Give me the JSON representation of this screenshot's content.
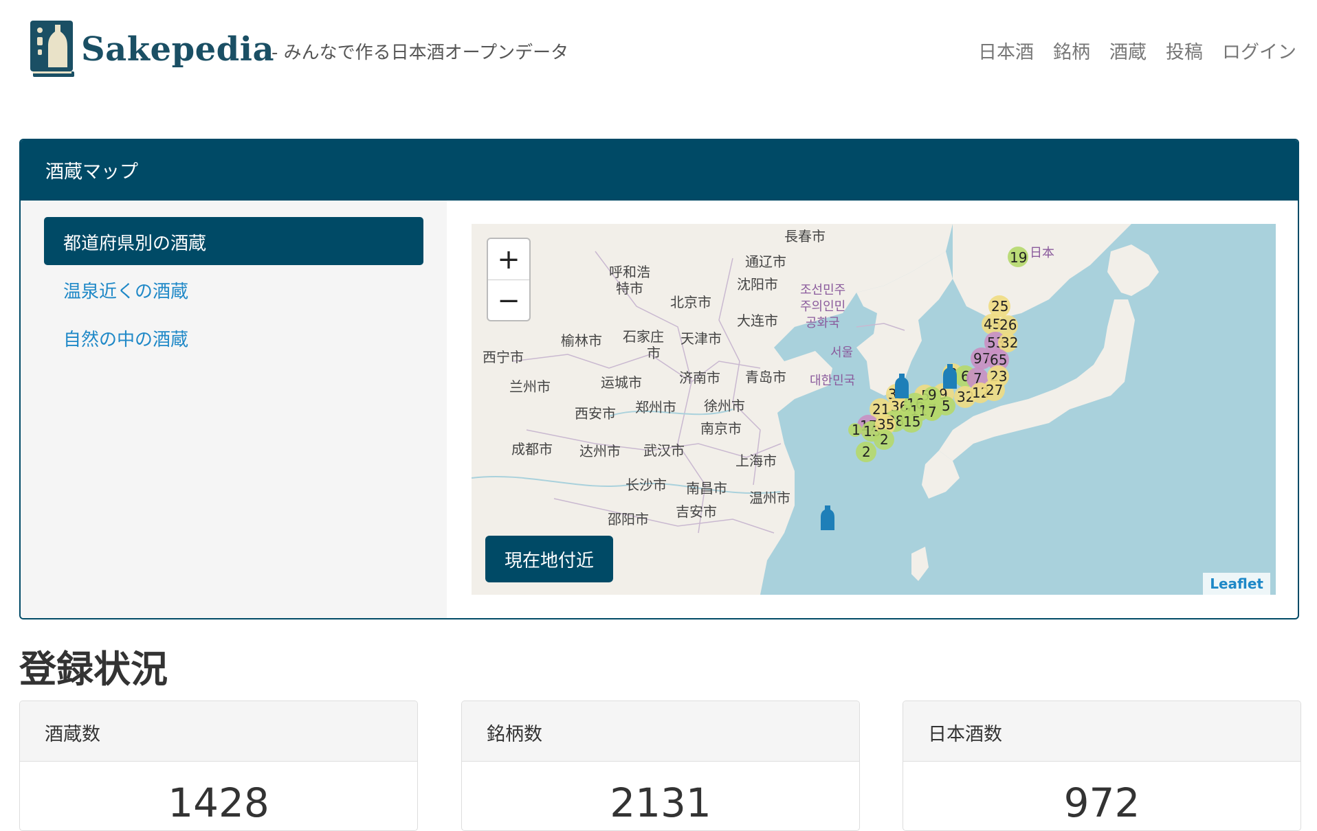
{
  "brand": {
    "name": "Sakepedia",
    "tagline": "- みんなで作る日本酒オープンデータ"
  },
  "nav": [
    {
      "label": "日本酒"
    },
    {
      "label": "銘柄"
    },
    {
      "label": "酒蔵"
    },
    {
      "label": "投稿"
    },
    {
      "label": "ログイン"
    }
  ],
  "panel": {
    "title": "酒蔵マップ",
    "menu": [
      {
        "label": "都道府県別の酒蔵",
        "active": true
      },
      {
        "label": "温泉近くの酒蔵",
        "active": false
      },
      {
        "label": "自然の中の酒蔵",
        "active": false
      }
    ]
  },
  "map": {
    "zoom_in": "+",
    "zoom_out": "−",
    "locate_button": "現在地付近",
    "attribution": "Leaflet",
    "cities": [
      "長春市",
      "通辽市",
      "呼和浩",
      "特市",
      "沈阳市",
      "北京市",
      "大连市",
      "榆林市",
      "石家庄",
      "市",
      "天津市",
      "西宁市",
      "兰州市",
      "运城市",
      "济南市",
      "青岛市",
      "西安市",
      "郑州市",
      "徐州市",
      "南京市",
      "成都市",
      "达州市",
      "武汉市",
      "上海市",
      "长沙市",
      "南昌市",
      "温州市",
      "邵阳市",
      "吉安市",
      "日本"
    ],
    "korea_labels": [
      "조선민주",
      "주의인민",
      "공화국",
      "서울",
      "대한민국"
    ],
    "clusters": [
      "19",
      "25",
      "45",
      "26",
      "53",
      "32",
      "97",
      "65",
      "3",
      "6",
      "7",
      "23",
      "31",
      "5",
      "9",
      "32",
      "12",
      "27",
      "21",
      "36",
      "16",
      "7",
      "5",
      "1",
      "9",
      "11",
      "7",
      "28",
      "15",
      "17",
      "13",
      "35",
      "2",
      "2",
      "1"
    ]
  },
  "stats": {
    "title": "登録状況",
    "items": [
      {
        "label": "酒蔵数",
        "value": "1428"
      },
      {
        "label": "銘柄数",
        "value": "2131"
      },
      {
        "label": "日本酒数",
        "value": "972"
      }
    ]
  }
}
